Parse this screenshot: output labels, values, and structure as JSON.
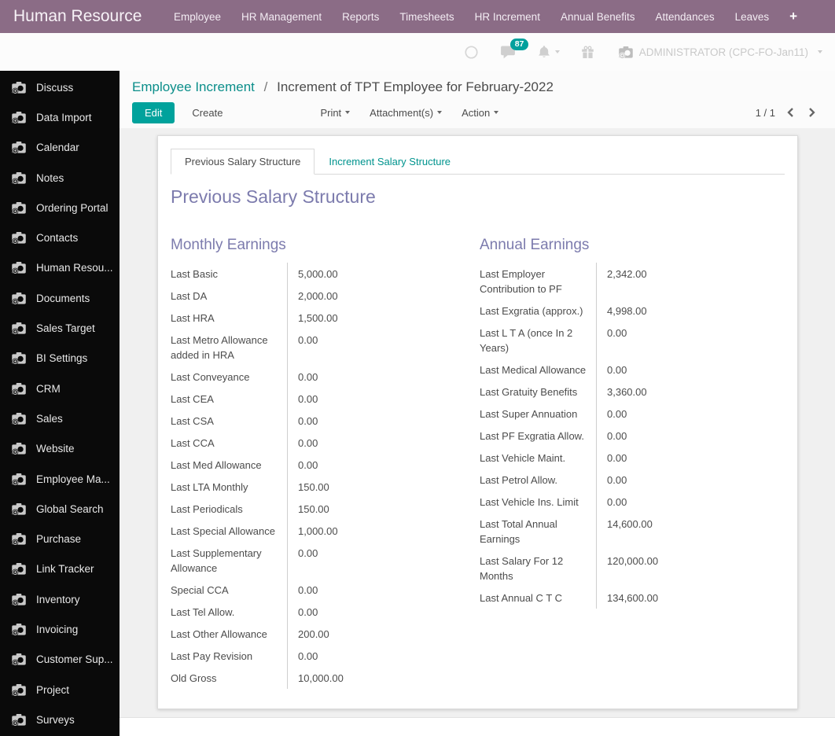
{
  "brand": "Human Resource",
  "icons": {
    "plus": "+"
  },
  "topnav": [
    {
      "label": "Employee"
    },
    {
      "label": "HR Management"
    },
    {
      "label": "Reports"
    },
    {
      "label": "Timesheets"
    },
    {
      "label": "HR Increment"
    },
    {
      "label": "Annual Benefits"
    },
    {
      "label": "Attendances"
    },
    {
      "label": "Leaves"
    }
  ],
  "systray": {
    "badge": "87",
    "user": "ADMINISTRATOR (CPC-FO-Jan11)"
  },
  "sidebar": {
    "items": [
      {
        "label": "Discuss"
      },
      {
        "label": "Data Import"
      },
      {
        "label": "Calendar"
      },
      {
        "label": "Notes"
      },
      {
        "label": "Ordering Portal"
      },
      {
        "label": "Contacts"
      },
      {
        "label": "Human Resou..."
      },
      {
        "label": "Documents"
      },
      {
        "label": "Sales Target"
      },
      {
        "label": "BI Settings"
      },
      {
        "label": "CRM"
      },
      {
        "label": "Sales"
      },
      {
        "label": "Website"
      },
      {
        "label": "Employee Ma..."
      },
      {
        "label": "Global Search"
      },
      {
        "label": "Purchase"
      },
      {
        "label": "Link Tracker"
      },
      {
        "label": "Inventory"
      },
      {
        "label": "Invoicing"
      },
      {
        "label": "Customer Sup..."
      },
      {
        "label": "Project"
      },
      {
        "label": "Surveys"
      }
    ]
  },
  "breadcrumb": {
    "parent": "Employee Increment",
    "separator": "/",
    "current": "Increment of TPT Employee for February-2022"
  },
  "toolbar": {
    "edit_label": "Edit",
    "create_label": "Create",
    "print_label": "Print",
    "attachments_label": "Attachment(s)",
    "action_label": "Action",
    "pager": "1 / 1"
  },
  "tabs": [
    {
      "label": "Previous Salary Structure",
      "active": true
    },
    {
      "label": "Increment Salary Structure",
      "active": false
    }
  ],
  "sheet": {
    "title": "Previous Salary Structure",
    "columns": [
      {
        "heading": "Monthly Earnings",
        "fields": [
          {
            "label": "Last Basic",
            "value": "5,000.00"
          },
          {
            "label": "Last DA",
            "value": "2,000.00"
          },
          {
            "label": "Last HRA",
            "value": "1,500.00"
          },
          {
            "label": "Last Metro Allowance added in HRA",
            "value": "0.00"
          },
          {
            "label": "Last Conveyance",
            "value": "0.00"
          },
          {
            "label": "Last CEA",
            "value": "0.00"
          },
          {
            "label": "Last CSA",
            "value": "0.00"
          },
          {
            "label": "Last CCA",
            "value": "0.00"
          },
          {
            "label": "Last Med Allowance",
            "value": "0.00"
          },
          {
            "label": "Last LTA Monthly",
            "value": "150.00"
          },
          {
            "label": "Last Periodicals",
            "value": "150.00"
          },
          {
            "label": "Last Special Allowance",
            "value": "1,000.00"
          },
          {
            "label": "Last Supplementary Allowance",
            "value": "0.00"
          },
          {
            "label": "Special CCA",
            "value": "0.00"
          },
          {
            "label": "Last Tel Allow.",
            "value": "0.00"
          },
          {
            "label": "Last Other Allowance",
            "value": "200.00"
          },
          {
            "label": "Last Pay Revision",
            "value": "0.00"
          },
          {
            "label": "Old Gross",
            "value": "10,000.00"
          }
        ]
      },
      {
        "heading": "Annual Earnings",
        "fields": [
          {
            "label": "Last Employer Contribution to PF",
            "value": "2,342.00"
          },
          {
            "label": "Last Exgratia (approx.)",
            "value": "4,998.00"
          },
          {
            "label": "Last L T A (once In 2 Years)",
            "value": "0.00"
          },
          {
            "label": "Last Medical Allowance",
            "value": "0.00"
          },
          {
            "label": "Last Gratuity Benefits",
            "value": "3,360.00"
          },
          {
            "label": "Last Super Annuation",
            "value": "0.00"
          },
          {
            "label": "Last PF Exgratia Allow.",
            "value": "0.00"
          },
          {
            "label": "Last Vehicle Maint.",
            "value": "0.00"
          },
          {
            "label": "Last Petrol Allow.",
            "value": "0.00"
          },
          {
            "label": "Last Vehicle Ins. Limit",
            "value": "0.00"
          },
          {
            "label": "Last Total Annual Earnings",
            "value": "14,600.00"
          },
          {
            "label": "Last Salary For 12 Months",
            "value": "120,000.00"
          },
          {
            "label": "Last Annual C T C",
            "value": "134,600.00"
          }
        ]
      }
    ]
  },
  "colors": {
    "topbar": "#8b6c86",
    "accent_teal": "#00a09d",
    "link_teal": "#0b8e8a",
    "heading_purple": "#7c7bad",
    "sidebar_bg": "#0a0a0a",
    "badge": "#00a09d"
  }
}
